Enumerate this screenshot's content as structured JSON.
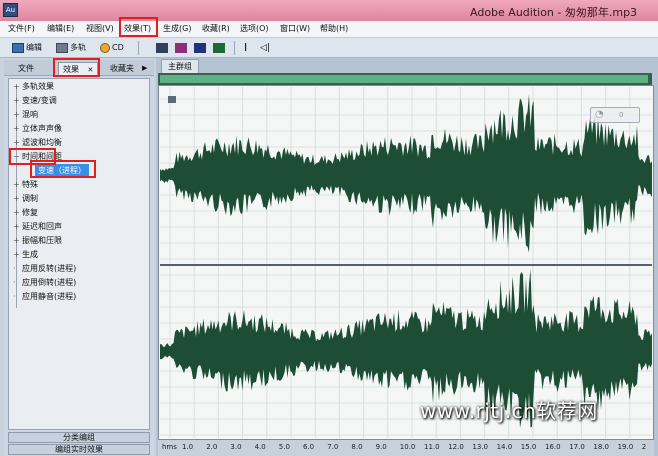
{
  "window": {
    "title": "Adobe Audition - 匆匆那年.mp3",
    "app_icon": "Au"
  },
  "menu": [
    {
      "label": "文件(F)"
    },
    {
      "label": "编辑(E)"
    },
    {
      "label": "视图(V)"
    },
    {
      "label": "效果(T)"
    },
    {
      "label": "生成(G)"
    },
    {
      "label": "收藏(R)"
    },
    {
      "label": "选项(O)"
    },
    {
      "label": "窗口(W)"
    },
    {
      "label": "帮助(H)"
    }
  ],
  "toolbar": {
    "edit_label": "编辑",
    "multitrack_label": "多轨",
    "cd_label": "CD"
  },
  "panel_tabs": {
    "files": "文件",
    "effects": "效果",
    "favorites": "收藏夹"
  },
  "tree": [
    "多轨效果",
    "变速/变调",
    "混响",
    "立体声声像",
    "滤波和均衡",
    "时间和间距",
    "变速（进程）",
    "特殊",
    "调制",
    "修复",
    "延迟和回声",
    "振幅和压限",
    "生成",
    "应用反转(进程)",
    "应用倒转(进程)",
    "应用静音(进程)"
  ],
  "bottom_buttons": {
    "sort": "分类编组",
    "realtime": "编组实时效果"
  },
  "main_tab": "主群组",
  "ruler": {
    "unit": "hms",
    "ticks": [
      "1.0",
      "2.0",
      "3.0",
      "4.0",
      "5.0",
      "6.0",
      "7.0",
      "8.0",
      "9.0",
      "10.0",
      "11.0",
      "12.0",
      "13.0",
      "14.0",
      "15.0",
      "16.0",
      "17.0",
      "18.0",
      "19.0",
      "2"
    ]
  },
  "mini_control_value": "0",
  "watermark": "www.rjtj.cn软荐网",
  "colors": {
    "highlight": "#e0201f",
    "waveform": "#1e4d36",
    "selected_item": "#3a8ee6"
  }
}
